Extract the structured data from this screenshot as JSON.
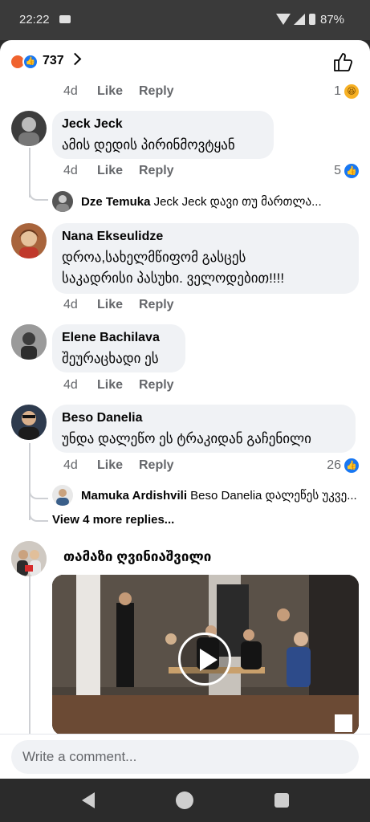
{
  "status_bar": {
    "time": "22:22",
    "battery": "87%"
  },
  "header": {
    "reaction_count": "737"
  },
  "colors": {
    "accent": "#1877f2",
    "bubble": "#f0f2f5",
    "muted": "#65676b"
  },
  "first_actions": {
    "time": "4d",
    "like": "Like",
    "reply": "Reply",
    "reaction_count": "1"
  },
  "comments": [
    {
      "name": "Jeck Jeck",
      "text": "ამის დედის პირინმოვტყან",
      "time": "4d",
      "like": "Like",
      "reply": "Reply",
      "reaction_count": "5",
      "reply_preview": {
        "name": "Dze Temuka",
        "text": "Jeck Jeck დავი თუ მართლა..."
      }
    },
    {
      "name": "Nana Ekseulidze",
      "text_line1": "დროა,სახელმწიფომ გასცეს",
      "text_line2": "საკადრისი პასუხი. ველოდებით!!!!",
      "time": "4d",
      "like": "Like",
      "reply": "Reply"
    },
    {
      "name": "Elene Bachilava",
      "text": "შეურაცხადი ეს",
      "time": "4d",
      "like": "Like",
      "reply": "Reply"
    },
    {
      "name": "Beso Danelia",
      "text": "უნდა დალეწო ეს ტრაკიდან გაჩენილი",
      "time": "4d",
      "like": "Like",
      "reply": "Reply",
      "reaction_count": "26",
      "reply_preview": {
        "name": "Mamuka Ardishvili",
        "text": "Beso Danelia დალეწეს უკვე..."
      },
      "more_replies": "View 4 more replies..."
    },
    {
      "name": "თამაზი ღვინიაშვილი"
    }
  ],
  "composer": {
    "placeholder": "Write a comment..."
  }
}
